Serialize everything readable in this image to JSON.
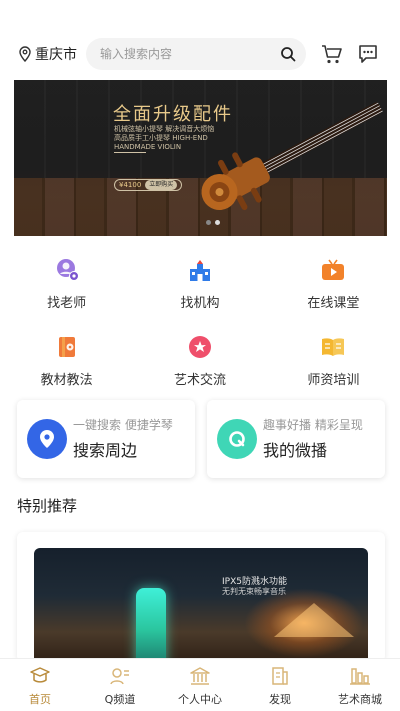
{
  "header": {
    "city": "重庆市",
    "search_placeholder": "输入搜索内容"
  },
  "banner": {
    "title": "全面升级配件",
    "subtitle_line1": "机械弦轴小提琴 解决调音大烦恼",
    "subtitle_line2": "高品质手工小提琴 HIGH-END HANDMADE VIOLIN",
    "price": "¥4100",
    "buy_label": "立即购买",
    "slide_count": 2,
    "active_slide": 1
  },
  "menu": [
    {
      "label": "找老师",
      "icon": "teacher-icon",
      "color": "#8f6ad8"
    },
    {
      "label": "找机构",
      "icon": "institution-icon",
      "color": "#2f7be8"
    },
    {
      "label": "在线课堂",
      "icon": "online-class-icon",
      "color": "#f2822a"
    },
    {
      "label": "教材教法",
      "icon": "textbook-icon",
      "color": "#f07a3a"
    },
    {
      "label": "艺术交流",
      "icon": "art-exchange-icon",
      "color": "#ef4f6b"
    },
    {
      "label": "师资培训",
      "icon": "training-icon",
      "color": "#f4b731"
    }
  ],
  "cards": [
    {
      "sub": "一键搜索 便捷学琴",
      "main": "搜索周边",
      "icon": "location-icon",
      "color": "#3366e6"
    },
    {
      "sub": "趣事好播 精彩呈现",
      "main": "我的微播",
      "icon": "micro-broadcast-icon",
      "color": "#3fd6b6"
    }
  ],
  "section_title": "特别推荐",
  "recommend": {
    "line1": "IPX5防溅水功能",
    "line2": "无判无束畅享音乐"
  },
  "tabs": [
    {
      "label": "首页",
      "icon": "home-icon",
      "active": true
    },
    {
      "label": "Q频道",
      "icon": "channel-icon",
      "active": false
    },
    {
      "label": "个人中心",
      "icon": "profile-icon",
      "active": false
    },
    {
      "label": "发现",
      "icon": "discover-icon",
      "active": false
    },
    {
      "label": "艺术商城",
      "icon": "mall-icon",
      "active": false
    }
  ],
  "colors": {
    "accent": "#b88a3a",
    "icon_gold": "#d9b679"
  }
}
